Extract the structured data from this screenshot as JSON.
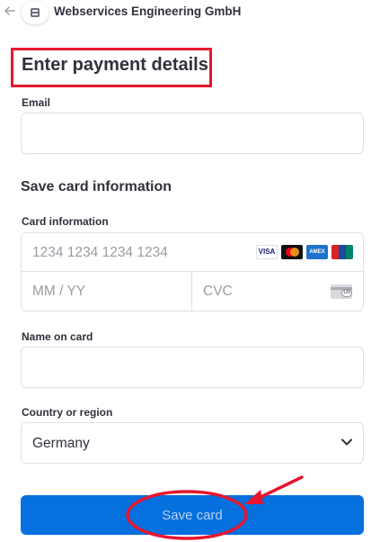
{
  "header": {
    "merchant_name": "Webservices Engineering GmbH",
    "back_icon": "arrow-left-icon",
    "logo_icon": "merchant-logo-icon"
  },
  "page": {
    "title": "Enter payment details"
  },
  "email": {
    "label": "Email",
    "value": ""
  },
  "section": {
    "title": "Save card information"
  },
  "card": {
    "label": "Card information",
    "number_placeholder": "1234 1234 1234 1234",
    "expiry_placeholder": "MM / YY",
    "cvc_placeholder": "CVC",
    "brands": [
      "VISA",
      "Mastercard",
      "AMEX",
      "UnionPay"
    ],
    "visa_text": "VISA",
    "amex_text": "AMEX",
    "unionpay_text": "UnionPay",
    "cvc_icon_text": "135"
  },
  "name_on_card": {
    "label": "Name on card",
    "value": ""
  },
  "country": {
    "label": "Country or region",
    "selected": "Germany"
  },
  "actions": {
    "save_label": "Save card"
  },
  "annotations": {
    "highlight_color": "#e8162f",
    "accent_button_color": "#0570de"
  }
}
